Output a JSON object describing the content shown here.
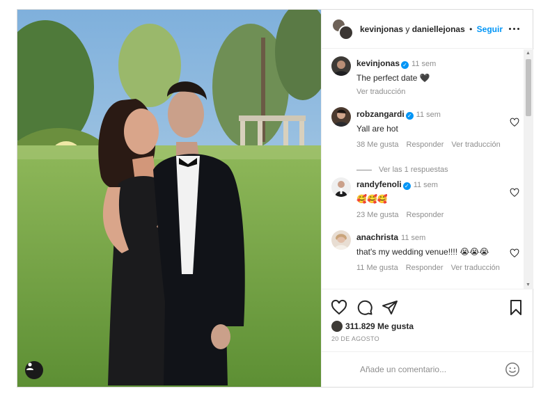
{
  "header": {
    "user1": "kevinjonas",
    "conjunction": "y",
    "user2": "daniellejonas",
    "separator": "•",
    "follow_label": "Seguir"
  },
  "caption": {
    "username": "kevinjonas",
    "time": "11 sem",
    "text": "The perfect date 🖤",
    "translate": "Ver traducción"
  },
  "comments": [
    {
      "username": "robzangardi",
      "verified": true,
      "time": "11 sem",
      "text": "Yall are hot",
      "likes": "38 Me gusta",
      "reply": "Responder",
      "translate": "Ver traducción"
    },
    {
      "username": "randyfenoli",
      "verified": true,
      "time": "11 sem",
      "text": "🥰🥰🥰",
      "likes": "23 Me gusta",
      "reply": "Responder"
    },
    {
      "username": "anachrista",
      "verified": false,
      "time": "11 sem",
      "text": "that's my wedding venue!!!! 😭😭😭",
      "likes": "11 Me gusta",
      "reply": "Responder",
      "translate": "Ver traducción"
    }
  ],
  "view_replies": "Ver las 1 respuestas",
  "post_stats": {
    "likes": "311.829 Me gusta",
    "date": "20 DE AGOSTO"
  },
  "add_comment": {
    "placeholder": "Añade un comentario..."
  },
  "icons": {
    "like": "heart-icon",
    "comment": "comment-icon",
    "share": "share-icon",
    "save": "bookmark-icon",
    "more": "more-icon",
    "emoji": "emoji-icon",
    "tagged": "user-tag-icon"
  },
  "colors": {
    "accent": "#0095f6",
    "muted": "#8e8e8e",
    "text": "#262626",
    "border": "#dbdbdb"
  }
}
